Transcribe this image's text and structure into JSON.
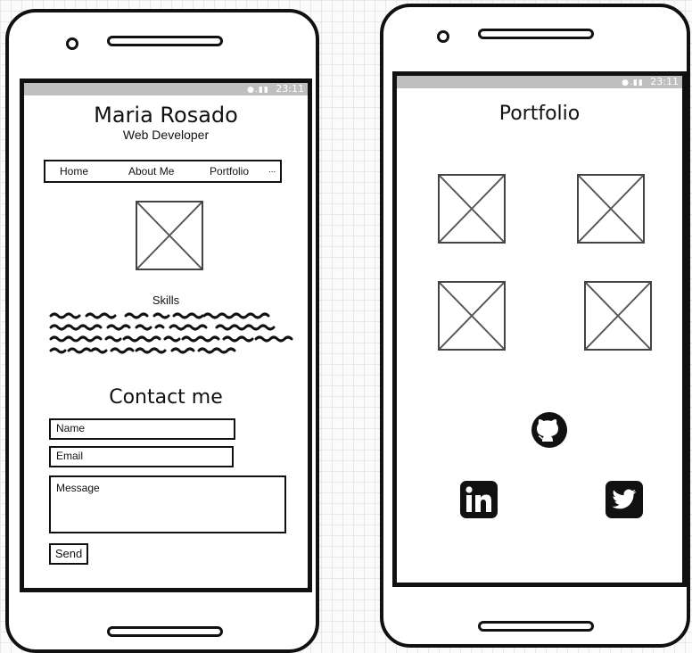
{
  "left_phone": {
    "status_time": "23:11",
    "header": {
      "name": "Maria Rosado",
      "subtitle": "Web Developer"
    },
    "nav": {
      "items": [
        {
          "label": "Home"
        },
        {
          "label": "About Me"
        },
        {
          "label": "Portfolio"
        },
        {
          "label": "..."
        }
      ]
    },
    "skills": {
      "label": "Skills"
    },
    "contact": {
      "title": "Contact me",
      "name_placeholder": "Name",
      "email_placeholder": "Email",
      "message_placeholder": "Message",
      "send_label": "Send"
    }
  },
  "right_phone": {
    "status_time": "23:11",
    "title": "Portfolio",
    "social_icons": [
      "github-icon",
      "linkedin-icon",
      "twitter-icon"
    ]
  }
}
